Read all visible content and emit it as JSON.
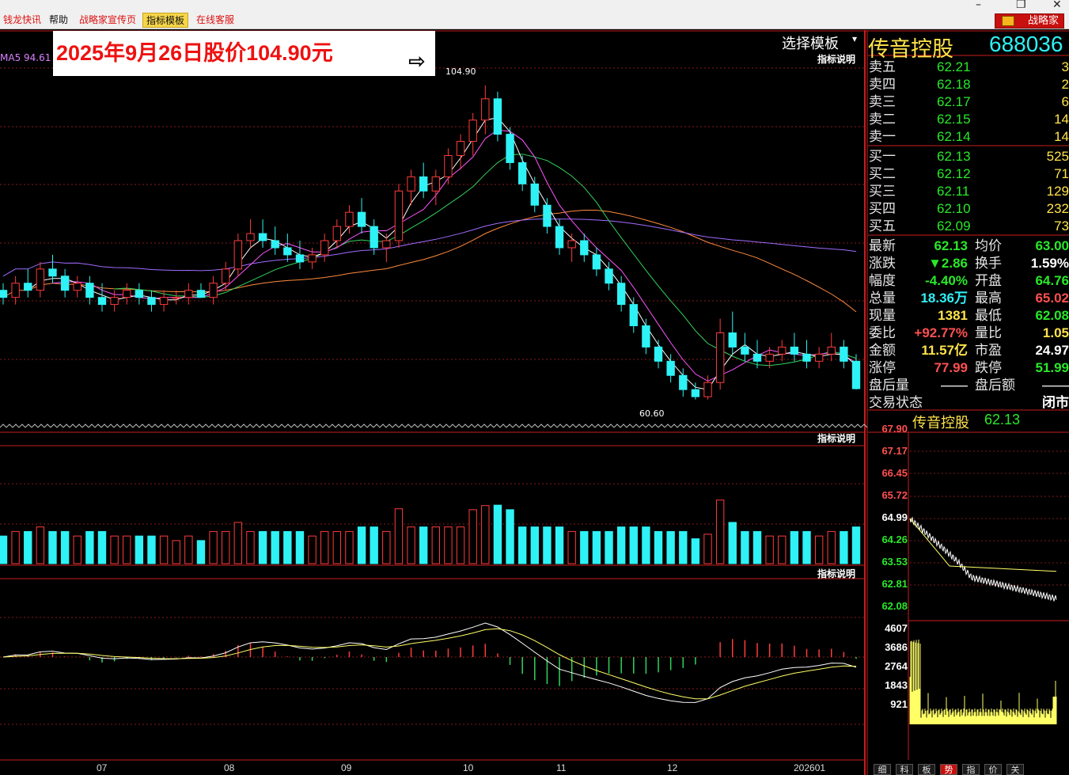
{
  "menu": {
    "items": [
      {
        "label": "钱龙快讯",
        "style": "red"
      },
      {
        "label": "帮助",
        "style": "normal"
      },
      {
        "label": "战略家宣传页",
        "style": "red"
      },
      {
        "label": "指标模板",
        "style": "active"
      },
      {
        "label": "在线客服",
        "style": "red"
      }
    ],
    "brand": "战略家",
    "window_buttons": [
      "–",
      "❐",
      "✕"
    ]
  },
  "chart_header": {
    "ma5_label": "MA5 94.61",
    "select_template": "选择模板",
    "indicator_note": "指标说明",
    "annotation": "2025年9月26日股价104.90元",
    "arrow_icon": "⇨",
    "high_label": "104.90",
    "low_label": "60.60"
  },
  "stock": {
    "name": "传音控股",
    "code": "688036"
  },
  "order_book": {
    "sell": [
      {
        "label": "卖五",
        "price": "62.21",
        "vol": "3"
      },
      {
        "label": "卖四",
        "price": "62.18",
        "vol": "2"
      },
      {
        "label": "卖三",
        "price": "62.17",
        "vol": "6"
      },
      {
        "label": "卖二",
        "price": "62.15",
        "vol": "14"
      },
      {
        "label": "卖一",
        "price": "62.14",
        "vol": "14"
      }
    ],
    "buy": [
      {
        "label": "买一",
        "price": "62.13",
        "vol": "525"
      },
      {
        "label": "买二",
        "price": "62.12",
        "vol": "71"
      },
      {
        "label": "买三",
        "price": "62.11",
        "vol": "129"
      },
      {
        "label": "买四",
        "price": "62.10",
        "vol": "232"
      },
      {
        "label": "买五",
        "price": "62.09",
        "vol": "73"
      }
    ]
  },
  "stats": [
    {
      "l1": "最新",
      "v1": "62.13",
      "c1": "#29e829",
      "l2": "均价",
      "v2": "63.00",
      "c2": "#29e829"
    },
    {
      "l1": "涨跌",
      "v1": "▼2.86",
      "c1": "#29e829",
      "l2": "换手",
      "v2": "1.59%",
      "c2": "#ffffff"
    },
    {
      "l1": "幅度",
      "v1": "-4.40%",
      "c1": "#29e829",
      "l2": "开盘",
      "v2": "64.76",
      "c2": "#29e829"
    },
    {
      "l1": "总量",
      "v1": "18.36万",
      "c1": "#2ef2f5",
      "l2": "最高",
      "v2": "65.02",
      "c2": "#ff5050"
    },
    {
      "l1": "现量",
      "v1": "1381",
      "c1": "#ffe34a",
      "l2": "最低",
      "v2": "62.08",
      "c2": "#29e829"
    },
    {
      "l1": "委比",
      "v1": "+92.77%",
      "c1": "#ff5050",
      "l2": "量比",
      "v2": "1.05",
      "c2": "#ffe34a"
    },
    {
      "l1": "金额",
      "v1": "11.57亿",
      "c1": "#ffe34a",
      "l2": "市盈",
      "v2": "24.97",
      "c2": "#ffffff"
    },
    {
      "l1": "涨停",
      "v1": "77.99",
      "c1": "#ff5050",
      "l2": "跌停",
      "v2": "51.99",
      "c2": "#29e829"
    },
    {
      "l1": "盘后量",
      "v1": "——",
      "c1": "#cccccc",
      "l2": "盘后额",
      "v2": "——",
      "c2": "#cccccc"
    },
    {
      "l1": "交易状态",
      "v1": "",
      "c1": "#ffffff",
      "l2": "",
      "v2": "闭市",
      "c2": "#ffffff"
    }
  ],
  "mini": {
    "title": "传音控股",
    "price": "62.13",
    "price_labels": [
      {
        "t": "67.90",
        "c": "#ff5050"
      },
      {
        "t": "67.17",
        "c": "#ff5050"
      },
      {
        "t": "66.45",
        "c": "#ff5050"
      },
      {
        "t": "65.72",
        "c": "#ff5050"
      },
      {
        "t": "64.99",
        "c": "#ffffff"
      },
      {
        "t": "64.26",
        "c": "#29e829"
      },
      {
        "t": "63.53",
        "c": "#29e829"
      },
      {
        "t": "62.81",
        "c": "#29e829"
      },
      {
        "t": "62.08",
        "c": "#29e829"
      }
    ],
    "vol_labels": [
      "4607",
      "3686",
      "2764",
      "1843",
      "921"
    ]
  },
  "x_labels": [
    "07",
    "08",
    "09",
    "10",
    "11",
    "12",
    "202601"
  ],
  "tabs": [
    "细",
    "科",
    "板",
    "势",
    "指",
    "价",
    "关"
  ],
  "chart_data": {
    "type": "candlestick",
    "x_months": [
      "07",
      "08",
      "09",
      "10",
      "11",
      "12",
      "202601"
    ],
    "high_marker": 104.9,
    "low_marker": 60.6,
    "ma5_value": 94.61,
    "last_price": 62.13,
    "ohlc_approx": [
      [
        76,
        77,
        74,
        75
      ],
      [
        75,
        78,
        74,
        77
      ],
      [
        77,
        79,
        75,
        76
      ],
      [
        76,
        80,
        75,
        79
      ],
      [
        79,
        81,
        77,
        78
      ],
      [
        78,
        79,
        75,
        76
      ],
      [
        76,
        78,
        75,
        77
      ],
      [
        77,
        78,
        74,
        75
      ],
      [
        75,
        77,
        73,
        74
      ],
      [
        74,
        76,
        73,
        75
      ],
      [
        75,
        77,
        74,
        76
      ],
      [
        76,
        77,
        74,
        75
      ],
      [
        75,
        76,
        73,
        74
      ],
      [
        74,
        76,
        73,
        75
      ],
      [
        75,
        76,
        74,
        75
      ],
      [
        75,
        77,
        74,
        76
      ],
      [
        76,
        77,
        75,
        75
      ],
      [
        75,
        78,
        74,
        77
      ],
      [
        77,
        80,
        76,
        79
      ],
      [
        79,
        84,
        78,
        83
      ],
      [
        83,
        86,
        82,
        84
      ],
      [
        84,
        86,
        82,
        83
      ],
      [
        83,
        85,
        81,
        82
      ],
      [
        82,
        84,
        80,
        81
      ],
      [
        81,
        83,
        79,
        80
      ],
      [
        80,
        82,
        79,
        81
      ],
      [
        81,
        84,
        80,
        83
      ],
      [
        83,
        86,
        82,
        85
      ],
      [
        85,
        88,
        84,
        87
      ],
      [
        87,
        89,
        84,
        85
      ],
      [
        85,
        86,
        81,
        82
      ],
      [
        82,
        84,
        80,
        83
      ],
      [
        83,
        91,
        82,
        90
      ],
      [
        90,
        93,
        88,
        92
      ],
      [
        92,
        94,
        89,
        90
      ],
      [
        90,
        93,
        88,
        92
      ],
      [
        92,
        96,
        91,
        95
      ],
      [
        95,
        98,
        93,
        97
      ],
      [
        97,
        101,
        95,
        100
      ],
      [
        100,
        104.9,
        98,
        103
      ],
      [
        103,
        104,
        97,
        98
      ],
      [
        98,
        99,
        93,
        94
      ],
      [
        94,
        95,
        90,
        91
      ],
      [
        91,
        92,
        87,
        88
      ],
      [
        88,
        89,
        84,
        85
      ],
      [
        85,
        86,
        81,
        82
      ],
      [
        82,
        84,
        80,
        83
      ],
      [
        83,
        84,
        80,
        81
      ],
      [
        81,
        82,
        78,
        79
      ],
      [
        79,
        80,
        76,
        77
      ],
      [
        77,
        78,
        73,
        74
      ],
      [
        74,
        75,
        70,
        71
      ],
      [
        71,
        72,
        67,
        68
      ],
      [
        68,
        69,
        65,
        66
      ],
      [
        66,
        67,
        63,
        64
      ],
      [
        64,
        65,
        61,
        62
      ],
      [
        62,
        63,
        60.6,
        61
      ],
      [
        61,
        64,
        60.6,
        63
      ],
      [
        63,
        72,
        62,
        70
      ],
      [
        70,
        73,
        67,
        68
      ],
      [
        68,
        70,
        66,
        67
      ],
      [
        67,
        69,
        65,
        66
      ],
      [
        66,
        68,
        65,
        67
      ],
      [
        67,
        69,
        66,
        68
      ],
      [
        68,
        70,
        66,
        67
      ],
      [
        67,
        69,
        65,
        66
      ],
      [
        66,
        68,
        65,
        67
      ],
      [
        67,
        70,
        66,
        68
      ],
      [
        68,
        69,
        65,
        66
      ],
      [
        66,
        67,
        62,
        62.13
      ]
    ]
  }
}
